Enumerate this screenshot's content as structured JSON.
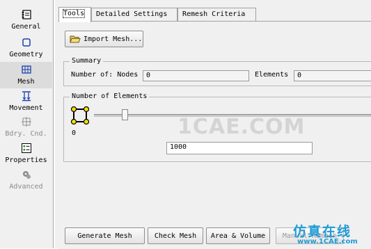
{
  "sidebar": {
    "items": [
      {
        "label": "General",
        "icon": "notebook-icon"
      },
      {
        "label": "Geometry",
        "icon": "square-icon"
      },
      {
        "label": "Mesh",
        "icon": "mesh-grid-icon",
        "active": true
      },
      {
        "label": "Movement",
        "icon": "movement-icon"
      },
      {
        "label": "Bdry. Cnd.",
        "icon": "boundary-icon",
        "disabled": true
      },
      {
        "label": "Properties",
        "icon": "properties-icon"
      },
      {
        "label": "Advanced",
        "icon": "gear-icon",
        "disabled": true
      }
    ]
  },
  "tabs": [
    "Tools",
    "Detailed Settings",
    "Remesh Criteria"
  ],
  "tools": {
    "import_label": "Import Mesh...",
    "summary": {
      "title": "Summary",
      "nodes_label": "Number of: Nodes",
      "nodes_value": "0",
      "elements_label": "Elements",
      "elements_value": "0"
    },
    "number_of_elements": {
      "title": "Number of Elements",
      "slider_min_label": "0",
      "slider_level": 0.11,
      "value": "1000"
    },
    "buttons": {
      "generate": "Generate Mesh",
      "check": "Check Mesh",
      "area_volume": "Area & Volume",
      "partial": "Manual Remesh"
    }
  },
  "watermark": {
    "center": "1CAE.COM",
    "corner_cn": "仿真在线",
    "corner_url": "www.1CAE.com"
  },
  "colors": {
    "accent": "#1f9bd6",
    "icon_yellow": "#f2e100"
  }
}
